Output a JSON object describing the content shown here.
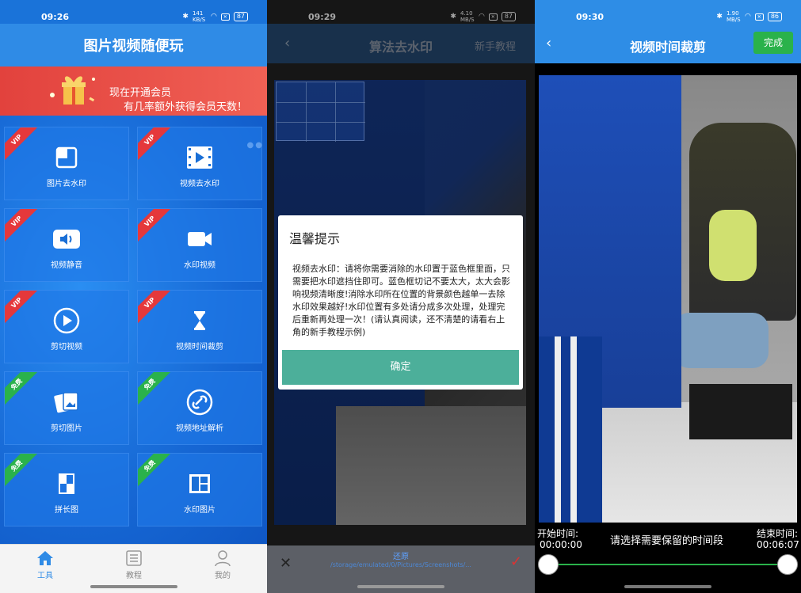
{
  "panel1": {
    "status": {
      "time": "09:26",
      "speed": "141 KB/S",
      "battery": "87"
    },
    "title": "图片视频随便玩",
    "promo": {
      "line1": "现在开通会员",
      "line2": "有几率额外获得会员天数！"
    },
    "tiles": [
      {
        "label": "图片去水印",
        "badge": "VIP",
        "icon": "image-icon"
      },
      {
        "label": "视频去水印",
        "badge": "VIP",
        "icon": "video-film-icon"
      },
      {
        "label": "视频静音",
        "badge": "VIP",
        "icon": "mute-icon"
      },
      {
        "label": "水印视频",
        "badge": "VIP",
        "icon": "video-camera-icon"
      },
      {
        "label": "剪切视频",
        "badge": "VIP",
        "icon": "play-circle-icon"
      },
      {
        "label": "视频时间裁剪",
        "badge": "VIP",
        "icon": "hourglass-icon"
      },
      {
        "label": "剪切图片",
        "badge": "免费",
        "icon": "photos-icon"
      },
      {
        "label": "视频地址解析",
        "badge": "免费",
        "icon": "link-icon"
      },
      {
        "label": "拼长图",
        "badge": "免费",
        "icon": "collage-icon"
      },
      {
        "label": "水印图片",
        "badge": "免费",
        "icon": "layout-icon"
      }
    ],
    "nav": [
      {
        "label": "工具",
        "icon": "home-icon",
        "active": true
      },
      {
        "label": "教程",
        "icon": "list-icon",
        "active": false
      },
      {
        "label": "我的",
        "icon": "profile-icon",
        "active": false
      }
    ]
  },
  "panel2": {
    "status": {
      "time": "09:29",
      "speed": "4.10 MB/S",
      "battery": "87"
    },
    "title": "算法去水印",
    "tutorial": "新手教程",
    "dialog": {
      "title": "温馨提示",
      "body": "视频去水印：请将你需要消除的水印置于蓝色框里面，只需要把水印遮挡住即可。蓝色框切记不要太大，太大会影响视频清晰度!消除水印所在位置的背景颜色越单一去除水印效果越好!水印位置有多处请分成多次处理，处理完后重新再处理一次！(请认真阅读，还不清楚的请看右上角的新手教程示例)",
      "confirm": "确定"
    },
    "bottom": {
      "reset": "还原",
      "path": "/storage/emulated/0/Pictures/Screenshots/..."
    }
  },
  "panel3": {
    "status": {
      "time": "09:30",
      "speed": "1.90 MB/S",
      "battery": "86"
    },
    "title": "视频时间裁剪",
    "done": "完成",
    "start_label": "开始时间:",
    "start_value": "00:00:00",
    "end_label": "结束时间:",
    "end_value": "00:06:07",
    "hint": "请选择需要保留的时间段"
  },
  "colors": {
    "primary": "#2f8be6",
    "vip": "#e5383b",
    "free": "#2ab24b",
    "confirm": "#4caf9a"
  }
}
